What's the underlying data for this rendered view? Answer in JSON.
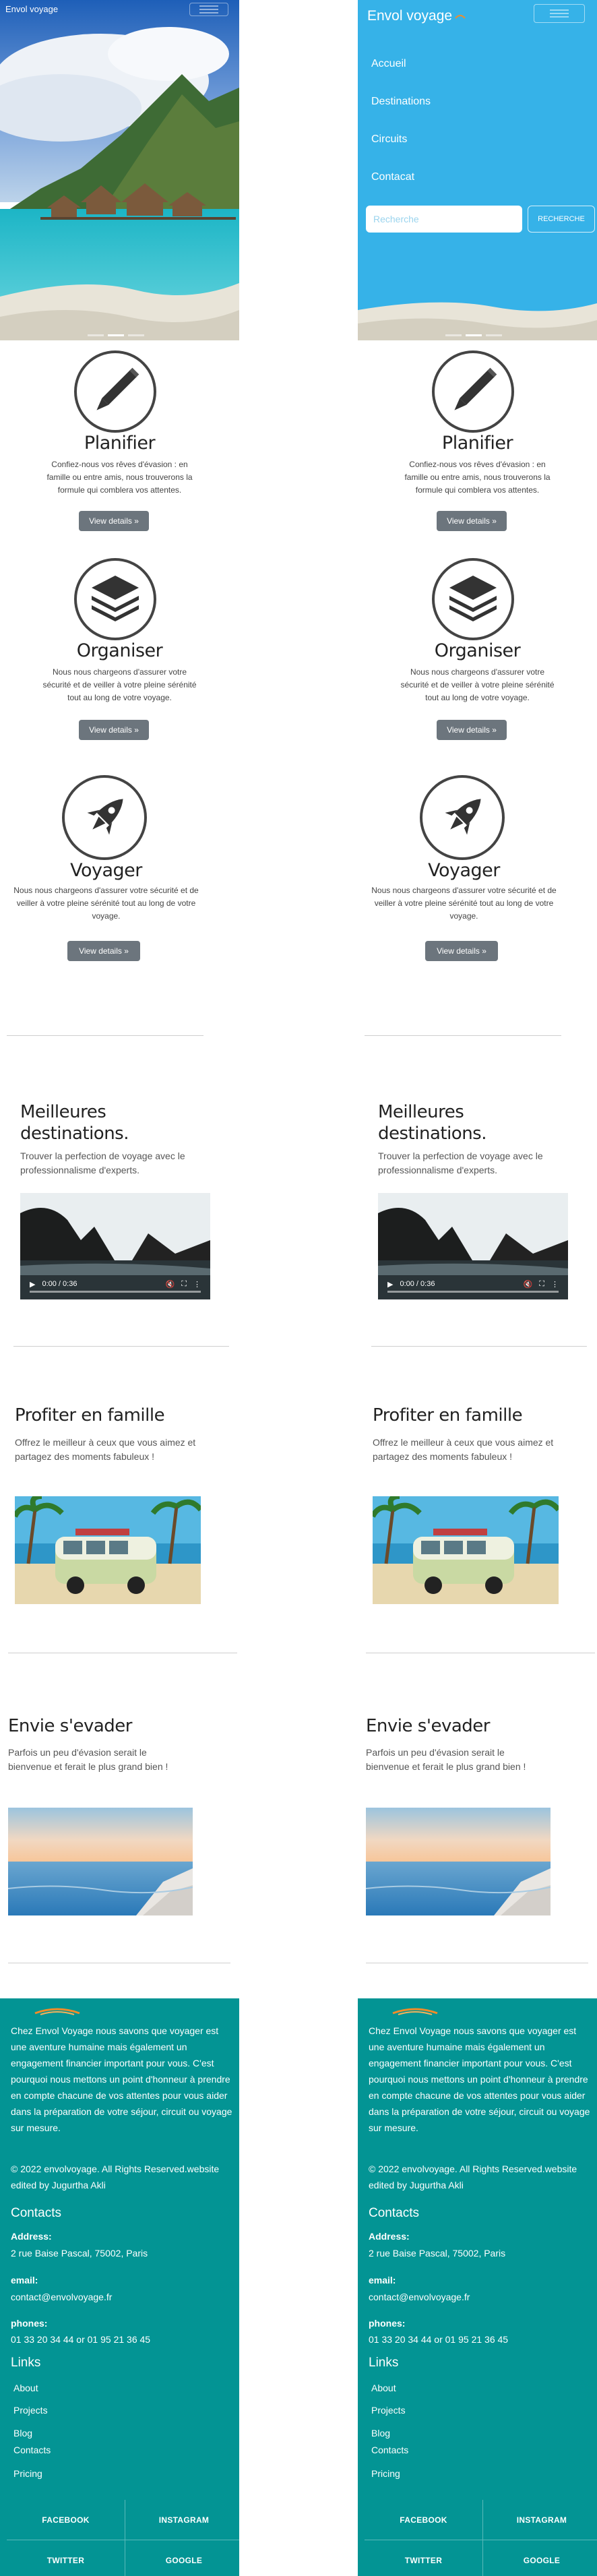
{
  "brand": "Envol voyage",
  "nav": {
    "items": [
      "Accueil",
      "Destinations",
      "Circuits",
      "Contacat"
    ],
    "search_placeholder": "Recherche",
    "search_button": "RECHERCHE"
  },
  "features": [
    {
      "title": "Planifier",
      "text": "Confiez-nous vos rêves d'évasion : en famille ou entre amis, nous trouverons la formule qui comblera vos attentes.",
      "button": "View details »",
      "icon": "pencil-icon"
    },
    {
      "title": "Organiser",
      "text": "Nous nous chargeons d'assurer votre sécurité et de veiller à votre pleine sérénité tout au long de votre voyage.",
      "button": "View details »",
      "icon": "layers-icon"
    },
    {
      "title": "Voyager",
      "text": "Nous nous chargeons d'assurer votre sécurité et de veiller à votre pleine sérénité tout au long de votre voyage.",
      "button": "View details »",
      "icon": "rocket-icon"
    }
  ],
  "sections": {
    "destinations": {
      "title": "Meilleures destinations.",
      "text": "Trouver la perfection de voyage avec le professionnalisme d'experts.",
      "video_time": "0:00 / 0:36"
    },
    "famille": {
      "title": "Profiter en famille",
      "text": "Offrez le meilleur à ceux que vous aimez et partagez des moments fabuleux !"
    },
    "evader": {
      "title": "Envie s'evader",
      "text": "Parfois un peu d'évasion serait le bienvenue et ferait le plus grand bien !"
    }
  },
  "footer": {
    "about": "Chez Envol Voyage nous savons que voyager est une aventure humaine mais également un engagement financier important pour vous. C'est pourquoi nous mettons un point d'honneur à prendre en compte chacune de vos attentes pour vous aider dans la préparation de votre séjour, circuit ou voyage sur mesure.",
    "copyright": "©  2022 envolvoyage. All Rights Reserved.website edited by Jugurtha Akli",
    "contacts_title": "Contacts",
    "address_label": "Address:",
    "address": "2 rue Baise Pascal, 75002, Paris",
    "email_label": "email:",
    "email": "contact@envolvoyage.fr",
    "phones_label": "phones:",
    "phones": "01 33 20 34 44 or 01 95 21 36 45",
    "links_title": "Links",
    "links": [
      "About",
      "Projects",
      "Blog",
      "Contacts",
      "Pricing"
    ],
    "socials": [
      "FACEBOOK",
      "INSTAGRAM",
      "TWITTER",
      "GOOGLE"
    ]
  }
}
